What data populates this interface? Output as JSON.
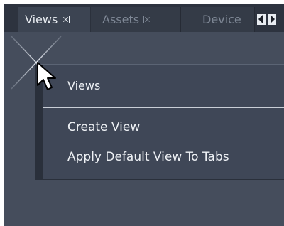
{
  "tabs": [
    {
      "label": "Views",
      "active": true
    },
    {
      "label": "Assets",
      "active": false
    },
    {
      "label": "Device",
      "active": false
    }
  ],
  "menu": {
    "header": "Views",
    "items": [
      "Create View",
      "Apply Default View To Tabs"
    ]
  },
  "icons": {
    "tab_close": "close-box-icon",
    "scroll_left": "arrow-left-icon",
    "scroll_right": "arrow-right-icon",
    "cursor": "mouse-pointer-icon"
  }
}
